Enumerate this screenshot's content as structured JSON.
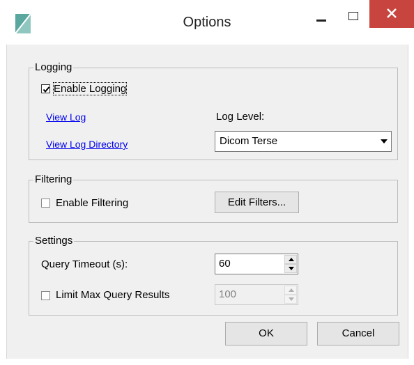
{
  "window": {
    "title": "Options",
    "icons": {
      "app": "app-icon",
      "minimize": "minimize-icon",
      "maximize": "maximize-icon",
      "close": "close-icon"
    },
    "colors": {
      "close_button": "#c7453e",
      "background": "#f0f0f0",
      "link": "#0000ee"
    }
  },
  "logging": {
    "legend": "Logging",
    "enable_label": "Enable Logging",
    "enable_checked": true,
    "view_log": "View Log",
    "view_log_directory": "View Log Directory",
    "log_level_label": "Log Level:",
    "log_level_value": "Dicom Terse",
    "dropdown_icon": "chevron-down-icon"
  },
  "filtering": {
    "legend": "Filtering",
    "enable_label": "Enable Filtering",
    "enable_checked": false,
    "edit_filters": "Edit Filters..."
  },
  "settings": {
    "legend": "Settings",
    "query_timeout_label": "Query Timeout (s):",
    "query_timeout_value": "60",
    "limit_label": "Limit Max Query Results",
    "limit_checked": false,
    "limit_value": "100"
  },
  "footer": {
    "ok": "OK",
    "cancel": "Cancel"
  }
}
